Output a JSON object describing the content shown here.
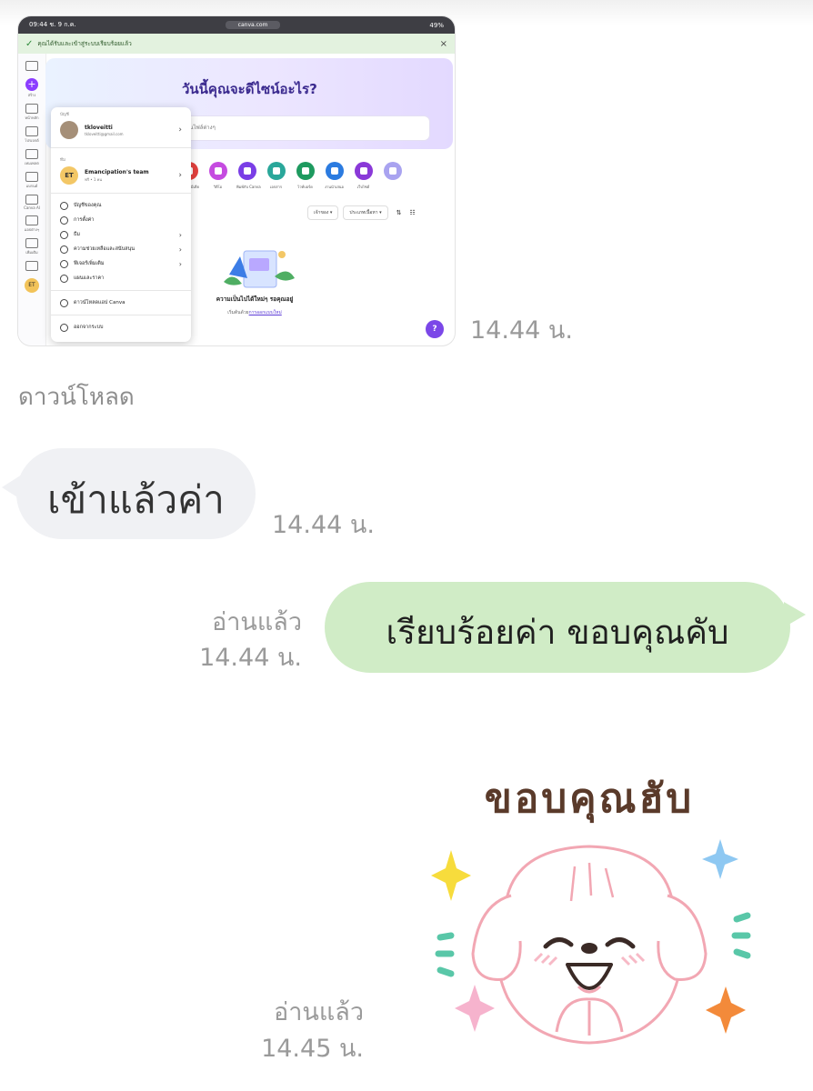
{
  "screenshot": {
    "status_bar": {
      "left": "09:44 ช. 9 ก.ค.",
      "center": "canva.com",
      "right": "49%"
    },
    "banner": {
      "text": "คุณได้รับและเข้าสู่ระบบเรียบร้อยแล้ว"
    },
    "hero_title": "วันนี้คุณจะดีไซน์อะไร?",
    "search_placeholder": "ค้นหาในไฟล์ต่างๆ",
    "rail": {
      "create": "สร้าง",
      "items": [
        "หน้าหลัก",
        "โปรเจกต์",
        "เทมเพลต",
        "แบรนด์",
        "Canva AI",
        "แอปต่างๆ",
        "เพิ่มเติม"
      ]
    },
    "quick_icons": [
      {
        "label": "โซเชียลมีเดีย",
        "color": "#e4413e"
      },
      {
        "label": "วิดีโอ",
        "color": "#c54be0"
      },
      {
        "label": "พิมพ์กับ Canva",
        "color": "#7a3ee6"
      },
      {
        "label": "เอกสาร",
        "color": "#2aa79a"
      },
      {
        "label": "ไวท์บอร์ด",
        "color": "#1e9a5f"
      },
      {
        "label": "งานนำเสนอ",
        "color": "#2b7be0"
      },
      {
        "label": "เว็บไซต์",
        "color": "#8a39d8"
      },
      {
        "label": "",
        "color": "#a9a3f0"
      }
    ],
    "filters": [
      "เจ้าของ",
      "ประเภทเนื้อหา"
    ],
    "empty_title": "ความเป็นไปได้ใหม่ๆ รอคุณอยู่",
    "empty_sub_prefix": "เริ่มต้นด้วย",
    "empty_sub_link": "การออกแบบใหม่",
    "help_label": "?",
    "menu": {
      "account_section": "บัญชี",
      "user_name": "tkloveitti",
      "user_email": "tkloveitti@gmail.com",
      "team_section": "ทีม",
      "team_initials": "ET",
      "team_name": "Emancipation's team",
      "team_sub": "ฟรี • 1 คน",
      "items": [
        {
          "label": "บัญชีของคุณ",
          "has_arrow": false
        },
        {
          "label": "การตั้งค่า",
          "has_arrow": false
        },
        {
          "label": "ธีม",
          "has_arrow": true
        },
        {
          "label": "ความช่วยเหลือและสนับสนุน",
          "has_arrow": true
        },
        {
          "label": "ฟีเจอร์เพิ่มเติม",
          "has_arrow": true
        },
        {
          "label": "แผนและราคา",
          "has_arrow": false
        },
        {
          "label": "ดาวน์โหลดแอป Canva",
          "has_arrow": false
        },
        {
          "label": "ออกจากระบบ",
          "has_arrow": false
        }
      ]
    }
  },
  "chat": {
    "screenshot_time": "14.44 น.",
    "caption": "ดาวน์โหลด",
    "incoming": {
      "text": "เข้าแล้วค่า",
      "time": "14.44 น."
    },
    "outgoing": {
      "text": "เรียบร้อยค่า ขอบคุณคับ",
      "read": "อ่านแล้ว",
      "time": "14.44 น."
    },
    "sticker": {
      "text": "ขอบคุณฮับ",
      "read": "อ่านแล้ว",
      "time": "14.45 น.",
      "palette": {
        "outline": "#f2a7b3",
        "blush": "#f7b9c6",
        "yellow": "#f7dc3c",
        "blue": "#8ec8f2",
        "orange": "#f38a3a",
        "pink": "#f6b3cd",
        "teal": "#59c7a8"
      }
    }
  }
}
